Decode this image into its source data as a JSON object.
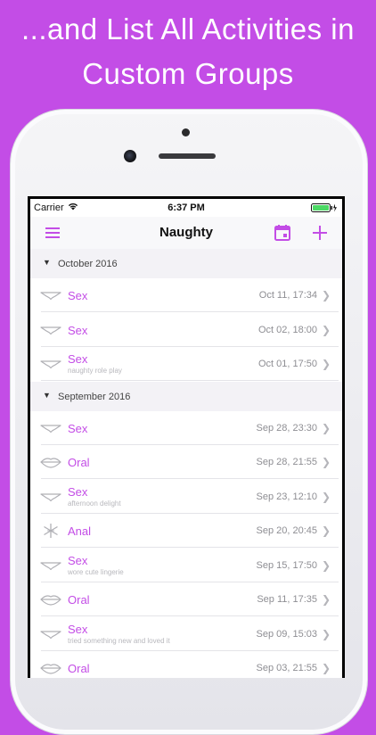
{
  "headline": {
    "line1": "...and List All Activities in",
    "line2": "Custom Groups"
  },
  "status_bar": {
    "carrier": "Carrier",
    "time": "6:37 PM"
  },
  "nav": {
    "title": "Naughty",
    "icons": [
      "menu-icon",
      "calendar-icon",
      "add-icon"
    ],
    "accent": "#c34de6"
  },
  "groups": [
    {
      "label": "October 2016",
      "items": [
        {
          "name": "Sex",
          "note": "",
          "date": "Oct 11, 17:34",
          "icon": "bra"
        },
        {
          "name": "Sex",
          "note": "",
          "date": "Oct 02, 18:00",
          "icon": "bra"
        },
        {
          "name": "Sex",
          "note": "naughty role play",
          "date": "Oct 01, 17:50",
          "icon": "bra"
        }
      ]
    },
    {
      "label": "September 2016",
      "items": [
        {
          "name": "Sex",
          "note": "",
          "date": "Sep 28, 23:30",
          "icon": "bra"
        },
        {
          "name": "Oral",
          "note": "",
          "date": "Sep 28, 21:55",
          "icon": "lips"
        },
        {
          "name": "Sex",
          "note": "afternoon delight",
          "date": "Sep 23, 12:10",
          "icon": "bra"
        },
        {
          "name": "Anal",
          "note": "",
          "date": "Sep 20, 20:45",
          "icon": "asterisk"
        },
        {
          "name": "Sex",
          "note": "wore cute lingerie",
          "date": "Sep 15, 17:50",
          "icon": "bra"
        },
        {
          "name": "Oral",
          "note": "",
          "date": "Sep 11, 17:35",
          "icon": "lips"
        },
        {
          "name": "Sex",
          "note": "tried something new and loved it",
          "date": "Sep 09, 15:03",
          "icon": "bra"
        },
        {
          "name": "Oral",
          "note": "",
          "date": "Sep 03, 21:55",
          "icon": "lips"
        }
      ]
    }
  ]
}
